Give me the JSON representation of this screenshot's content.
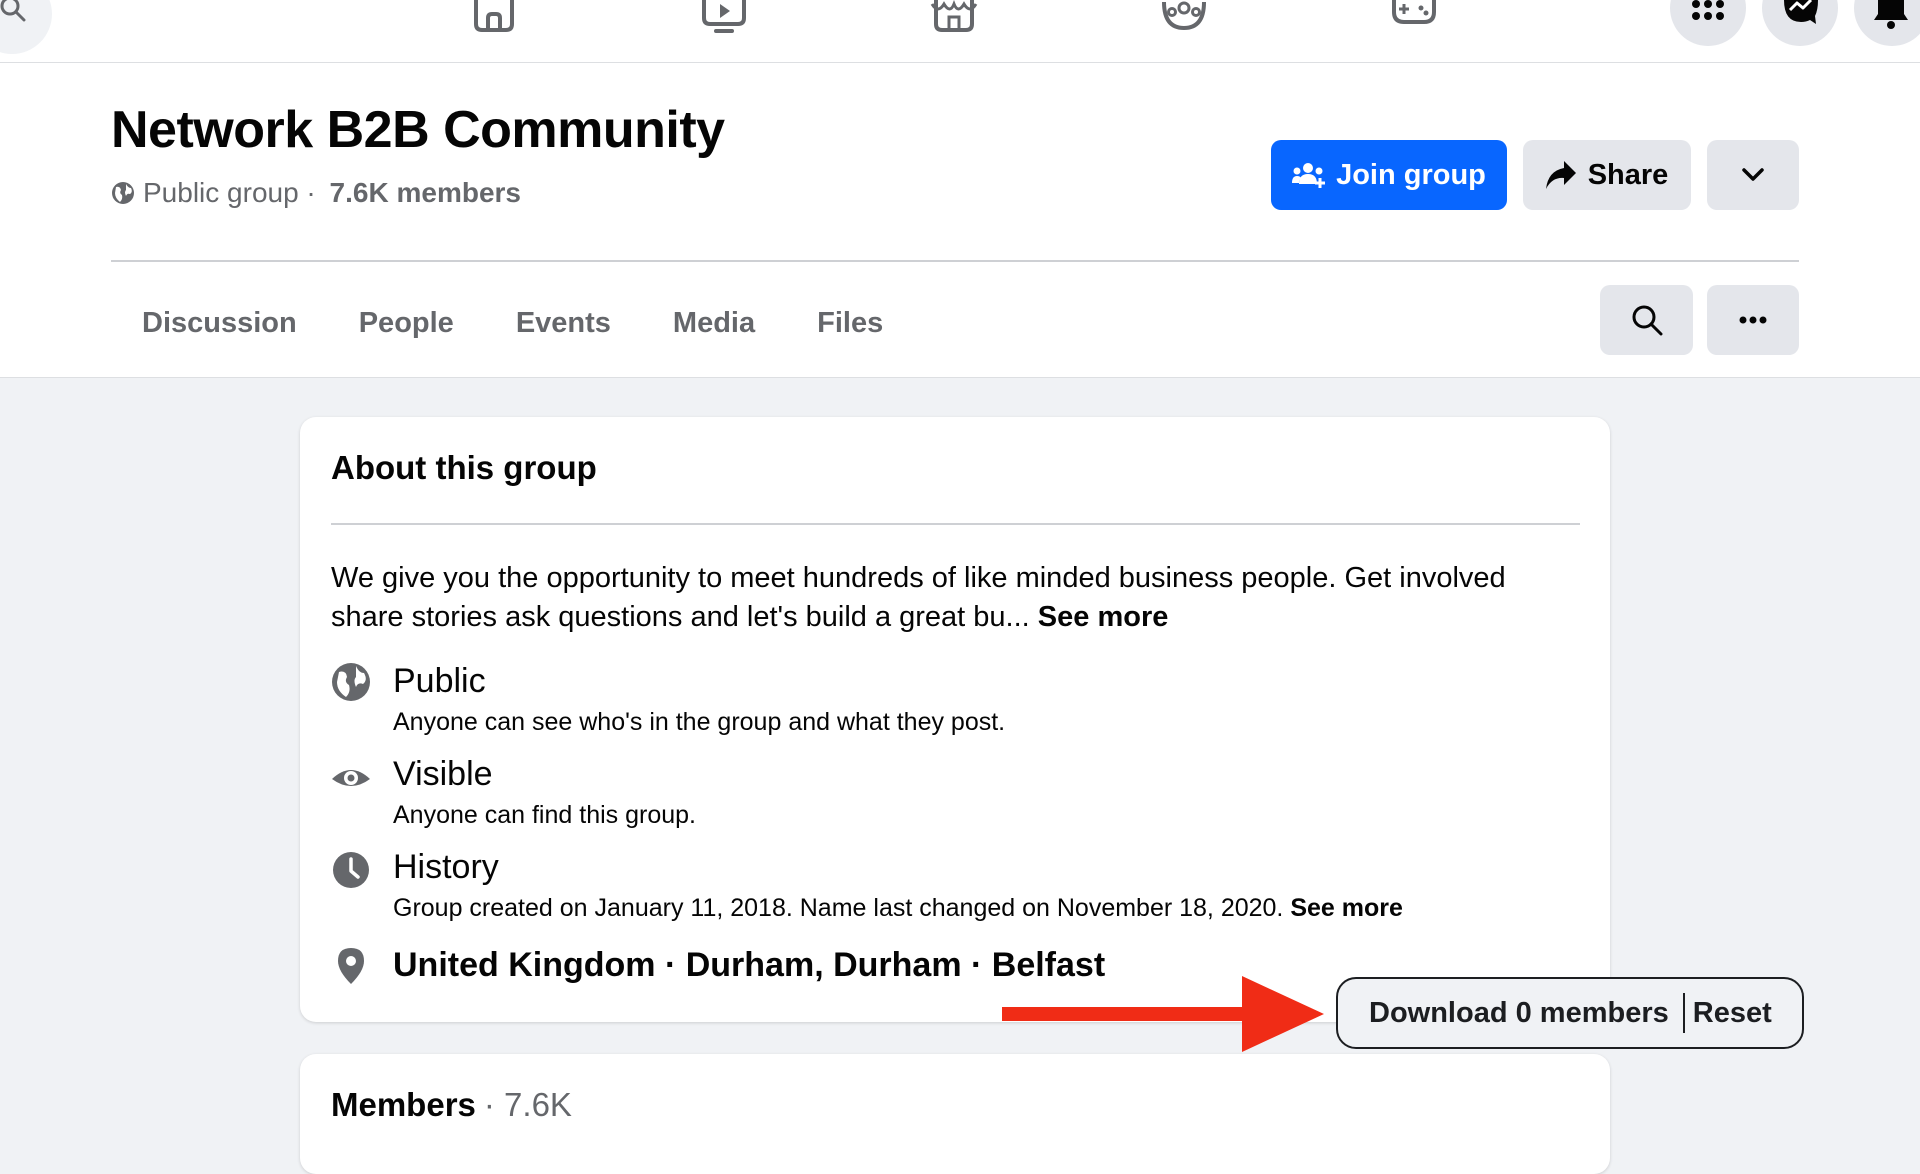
{
  "nav": {
    "icons": [
      "search-icon",
      "home-icon",
      "watch-icon",
      "marketplace-icon",
      "groups-icon",
      "gaming-icon",
      "menu-grid-icon",
      "messenger-icon",
      "notifications-icon"
    ]
  },
  "group": {
    "name": "Network B2B Community",
    "privacy": "Public group",
    "separator": " · ",
    "members": "7.6K members"
  },
  "actions": {
    "join": "Join group",
    "share": "Share"
  },
  "tabs": [
    {
      "label": "Discussion"
    },
    {
      "label": "People"
    },
    {
      "label": "Events"
    },
    {
      "label": "Media"
    },
    {
      "label": "Files"
    }
  ],
  "about": {
    "title": "About this group",
    "description": "We give you the opportunity to meet hundreds of like minded business people. Get involved share stories ask questions and let's build a great bu... ",
    "see_more": "See more",
    "public": {
      "title": "Public",
      "subtitle": "Anyone can see who's in the group and what they post."
    },
    "visible": {
      "title": "Visible",
      "subtitle": "Anyone can find this group."
    },
    "history": {
      "title": "History",
      "subtitle": "Group created on January 11, 2018. Name last changed on November 18, 2020. ",
      "see_more": "See more"
    },
    "location": "United Kingdom · Durham, Durham · Belfast"
  },
  "members_card": {
    "title": "Members",
    "count": "· 7.6K"
  },
  "overlay": {
    "download": "Download 0 members",
    "reset": "Reset",
    "arrow_color": "#f02c16"
  },
  "colors": {
    "accent": "#0866ff",
    "secondary_text": "#65676b",
    "button_bg": "#e4e6eb",
    "page_bg": "#f0f2f5"
  }
}
